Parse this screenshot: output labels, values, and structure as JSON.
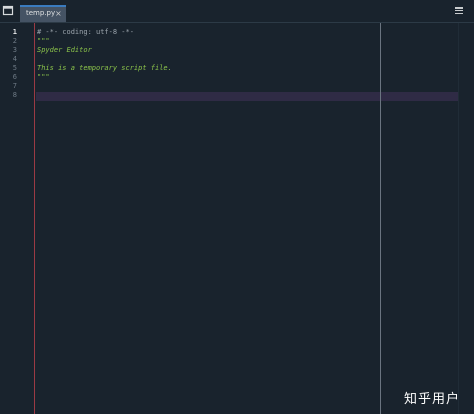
{
  "tabbar": {
    "browse_icon": "browse-tabs-icon",
    "tabs": [
      {
        "label": "temp.py",
        "close": "×"
      }
    ],
    "menu_icon": "hamburger-menu-icon"
  },
  "editor": {
    "line_numbers": [
      "1",
      "2",
      "3",
      "4",
      "5",
      "6",
      "7",
      "8"
    ],
    "active_line": "1",
    "lines": [
      "# -*- coding: utf-8 -*-",
      "\"\"\"",
      "Spyder Editor",
      "",
      "This is a temporary script file.",
      "\"\"\"",
      "",
      ""
    ],
    "colors": {
      "background": "#19232d",
      "comment": "#9aa3ab",
      "docstring": "#8bc34a",
      "gutter_border": "#9b3a44",
      "current_line": "#2f2b45"
    }
  },
  "watermark": "知乎用户"
}
